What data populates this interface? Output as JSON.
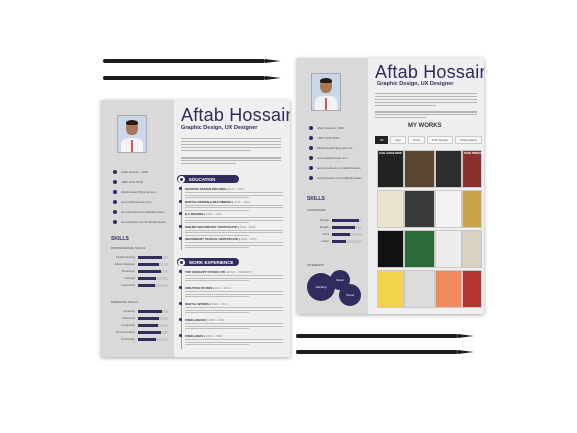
{
  "page_left": {
    "name": "Aftab Hossain",
    "role": "Graphic Design, UX Designer",
    "contacts": [
      "Aftab Hossain, 1990",
      "+880 1234 5678",
      "aftabhossain7@gmail.com",
      "www.aftabhossain.com",
      "www.facebook.com/aftabhossain",
      "www.linkedin.com/in/aftabhossain"
    ],
    "skills_title": "SKILLS",
    "skills_sub1": "PROFESSIONAL SKILLS",
    "skills1": [
      {
        "name": "Digital Painting",
        "level": 0.8
      },
      {
        "name": "Adobe Illustrator",
        "level": 0.7
      },
      {
        "name": "Photoshop",
        "level": 0.75
      },
      {
        "name": "Indesign",
        "level": 0.6
      },
      {
        "name": "Corel Draw",
        "level": 0.55
      }
    ],
    "skills_sub2": "PERSONAL SKILLS",
    "skills2": [
      {
        "name": "Creativity",
        "level": 0.8
      },
      {
        "name": "Teamwork",
        "level": 0.7
      },
      {
        "name": "Leadership",
        "level": 0.65
      },
      {
        "name": "Communication",
        "level": 0.75
      },
      {
        "name": "Punctuality",
        "level": 0.6
      }
    ],
    "education_title": "EDUCATION",
    "education": [
      {
        "title": "GRAPHIC DESIGN DIPLOMA",
        "date": "2012 - 2013"
      },
      {
        "title": "DIGITAL DESIGN & MULTIMEDIA",
        "date": "2010 - 2012"
      },
      {
        "title": "B.A DEGREE",
        "date": "2006 - 2010"
      },
      {
        "title": "HIGHER SECONDARY CERTIFICATE",
        "date": "2004 - 2006"
      },
      {
        "title": "SECONDARY SCHOOL CERTIFICATE",
        "date": "2002 - 2004"
      }
    ],
    "work_title": "WORK EXPERIENCE",
    "work": [
      {
        "title": "TOP CONCEPT STUDIO LTD.",
        "date": "2013 - PRESENT"
      },
      {
        "title": "CREATIVE STUDIO",
        "date": "2011 - 2013"
      },
      {
        "title": "DIGITAL WORKS",
        "date": "2010 - 2011"
      },
      {
        "title": "FREELANCER",
        "date": "2008 - 2010"
      },
      {
        "title": "FREELANCE",
        "date": "2006 - 2008"
      }
    ]
  },
  "page_right": {
    "name": "Aftab Hossain",
    "role": "Graphic Design, UX Designer",
    "contacts": [
      "Aftab Hossain, 1990",
      "+880 1234 5678",
      "aftabhossain7@gmail.com",
      "www.aftabhossain.com",
      "www.facebook.com/aftabhossain",
      "www.linkedin.com/in/aftabhossain"
    ],
    "skills_title": "SKILLS",
    "skills_sub": "LANGUAGES",
    "skills": [
      {
        "name": "Bangla",
        "level": 0.9
      },
      {
        "name": "English",
        "level": 0.75
      },
      {
        "name": "Hindi",
        "level": 0.6
      },
      {
        "name": "Arabic",
        "level": 0.45
      }
    ],
    "interests_title": "INTERESTS",
    "interests": [
      "Painting",
      "Music",
      "Travel"
    ],
    "works_title": "MY WORKS",
    "tabs": [
      "All",
      "App",
      "Icons",
      "Print Design",
      "Photography"
    ],
    "thumb_captions": [
      "CHALLENGE MIND",
      "",
      "",
      "FOOD PRINTABLES",
      "",
      "",
      "",
      "",
      "",
      "",
      "",
      "",
      "",
      "",
      "",
      ""
    ]
  }
}
